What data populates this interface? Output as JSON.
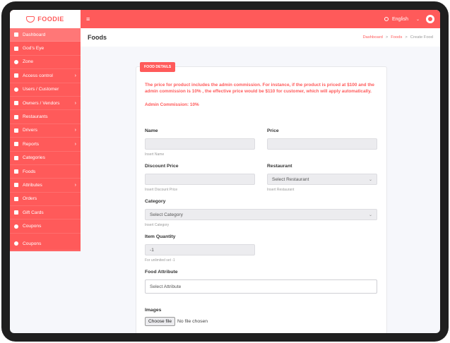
{
  "brand": {
    "name": "FOODIE"
  },
  "sidebar": {
    "items": [
      {
        "label": "Dashboard",
        "icon": "home-icon",
        "chevron": false,
        "active": true
      },
      {
        "label": "God's Eye",
        "icon": "eye-icon",
        "chevron": false
      },
      {
        "label": "Zone",
        "icon": "zone-icon",
        "chevron": false
      },
      {
        "label": "Access control",
        "icon": "lock-icon",
        "chevron": true
      },
      {
        "label": "Users / Customer",
        "icon": "users-icon",
        "chevron": false
      },
      {
        "label": "Owners / Vendors",
        "icon": "owners-icon",
        "chevron": true
      },
      {
        "label": "Restaurants",
        "icon": "store-icon",
        "chevron": false
      },
      {
        "label": "Drivers",
        "icon": "driver-icon",
        "chevron": true
      },
      {
        "label": "Reports",
        "icon": "report-icon",
        "chevron": true
      },
      {
        "label": "Categories",
        "icon": "category-icon",
        "chevron": false
      },
      {
        "label": "Foods",
        "icon": "food-icon",
        "chevron": false
      },
      {
        "label": "Attributes",
        "icon": "attribute-icon",
        "chevron": true
      },
      {
        "label": "Orders",
        "icon": "orders-icon",
        "chevron": false
      },
      {
        "label": "Gift Cards",
        "icon": "gift-icon",
        "chevron": false
      },
      {
        "label": "Coupons",
        "icon": "coupon-icon",
        "chevron": false
      },
      {
        "label": "Coupons",
        "icon": "coupon-icon",
        "chevron": false
      }
    ]
  },
  "topbar": {
    "menu_glyph": "≡",
    "language": "English"
  },
  "header": {
    "title": "Foods",
    "breadcrumb": [
      "Dashboard",
      "Foods",
      "Create Food"
    ],
    "separator": ">"
  },
  "card": {
    "tab": "FOOD DETAILS",
    "notice": "The price for product includes the admin commission. For instance, if the product is priced at $100 and the admin commission is 10% , the effective price would be $110 for customer, which will apply automatically.",
    "commission": "Admin Commission: 10%"
  },
  "form": {
    "name": {
      "label": "Name",
      "value": "",
      "help": "Insert Name"
    },
    "price": {
      "label": "Price",
      "value": ""
    },
    "discount": {
      "label": "Discount Price",
      "value": "",
      "help": "Insert Discount Price"
    },
    "restaurant": {
      "label": "Restaurant",
      "selected": "Select Restaurant",
      "help": "Insert Restaurant"
    },
    "category": {
      "label": "Category",
      "selected": "Select Category",
      "help": "Insert Category"
    },
    "quantity": {
      "label": "Item Quantity",
      "value": "-1",
      "help": "For unlimited set -1"
    },
    "attribute": {
      "label": "Food Attribute",
      "value": "Select Attribute"
    },
    "images": {
      "label": "Images",
      "button": "Choose file",
      "status": "No file chosen"
    }
  },
  "colors": {
    "accent": "#ff5a5a",
    "background": "#f6f7fb"
  }
}
